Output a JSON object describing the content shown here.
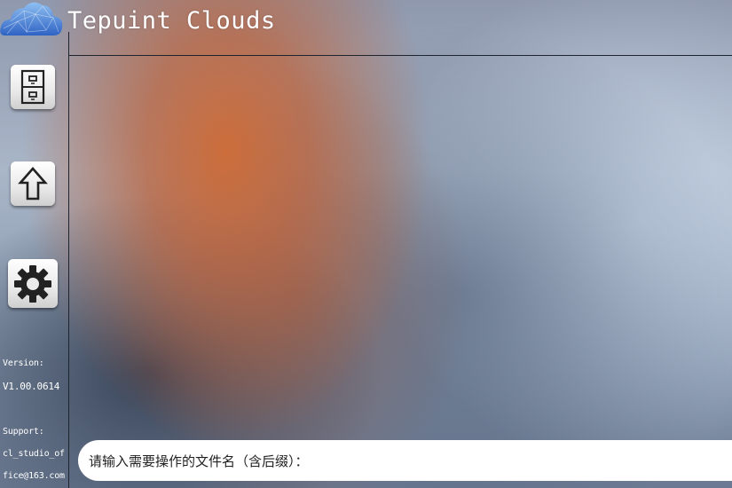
{
  "app": {
    "title": "Tepuint Clouds",
    "logo_icon": "cloud-logo-icon"
  },
  "sidebar": {
    "buttons": [
      {
        "name": "files-button",
        "icon": "file-cabinet-icon"
      },
      {
        "name": "upload-button",
        "icon": "up-arrow-icon"
      },
      {
        "name": "settings-button",
        "icon": "gear-icon"
      }
    ],
    "version_label": "Version:",
    "version_value": "V1.00.0614",
    "support_label": "Support:",
    "support_line1": "cl_studio_of",
    "support_line2": "fice@163.com"
  },
  "input": {
    "placeholder": "请输入需要操作的文件名（含后缀）：",
    "value": ""
  },
  "colors": {
    "accent_orange": "#ce6a34",
    "bg_blue": "#a9b6c8",
    "divider": "#1e2330",
    "logo_blue": "#4a86d8"
  }
}
